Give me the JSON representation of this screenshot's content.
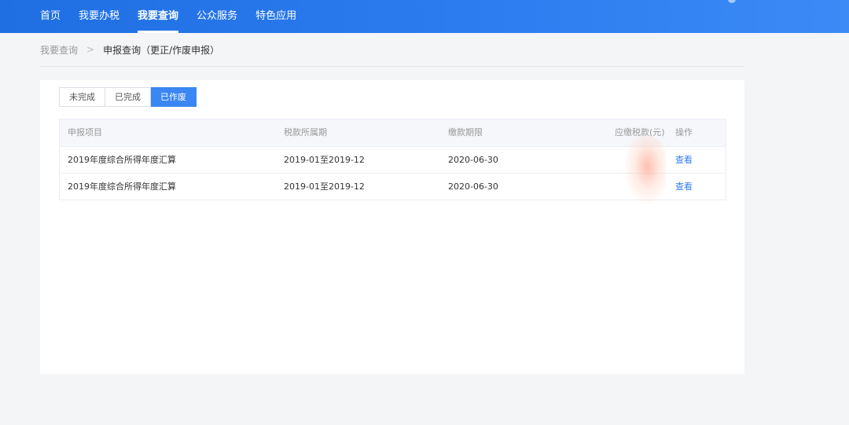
{
  "nav": {
    "items": [
      {
        "label": "首页"
      },
      {
        "label": "我要办税"
      },
      {
        "label": "我要查询"
      },
      {
        "label": "公众服务"
      },
      {
        "label": "特色应用"
      }
    ],
    "active": "我要查询"
  },
  "breadcrumb": {
    "parent": "我要查询",
    "separator": ">",
    "current": "申报查询（更正/作废申报）"
  },
  "tabs": [
    {
      "label": "未完成"
    },
    {
      "label": "已完成"
    },
    {
      "label": "已作废"
    }
  ],
  "active_tab": "已作废",
  "table": {
    "headers": [
      "申报项目",
      "税款所属期",
      "缴款期限",
      "应缴税款(元)",
      "操作"
    ],
    "rows": [
      {
        "item": "2019年度综合所得年度汇算",
        "period": "2019-01至2019-12",
        "deadline": "2020-06-30",
        "tax": "",
        "action": "查看"
      },
      {
        "item": "2019年度综合所得年度汇算",
        "period": "2019-01至2019-12",
        "deadline": "2020-06-30",
        "tax": "",
        "action": "查看"
      }
    ]
  },
  "colors": {
    "nav_bg": "#2c7cf0",
    "accent": "#3a86f2",
    "link": "#2f7cf0"
  }
}
